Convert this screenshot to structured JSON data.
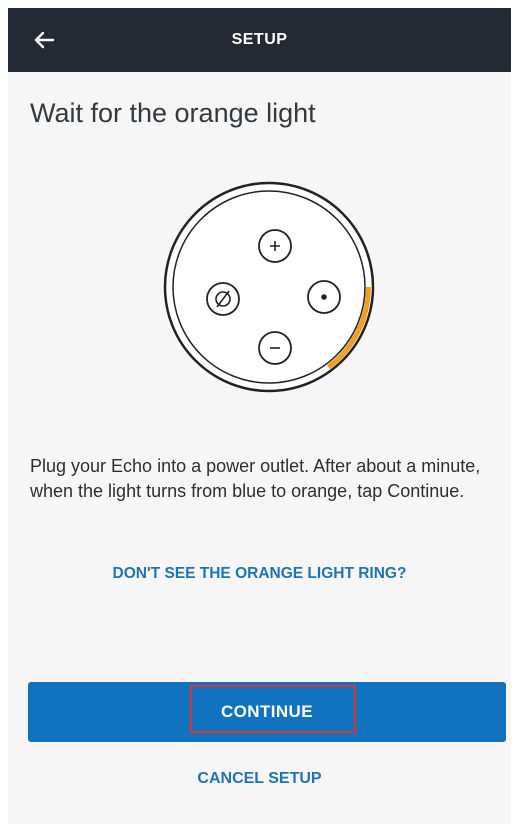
{
  "header": {
    "title": "SETUP",
    "back_icon": "arrow-left-icon"
  },
  "main": {
    "heading": "Wait for the orange light",
    "device": {
      "buttons": [
        {
          "icon": "plus-icon",
          "symbol": "+"
        },
        {
          "icon": "microphone-off-icon",
          "symbol": "Ø"
        },
        {
          "icon": "action-dot-icon",
          "symbol": "•"
        },
        {
          "icon": "minus-icon",
          "symbol": "−"
        }
      ],
      "ring_color": "#f0a020",
      "light_ring_progress": 0.2
    },
    "instructions": "Plug your Echo into a power outlet. After about a minute, when the light turns from blue to orange, tap Continue.",
    "help_link": "DON'T SEE THE ORANGE LIGHT RING?",
    "continue_label": "CONTINUE",
    "cancel_label": "CANCEL SETUP"
  },
  "colors": {
    "topbar": "#232a33",
    "accent": "#1173c0",
    "link": "#1f73b7",
    "highlight": "#e03030"
  }
}
